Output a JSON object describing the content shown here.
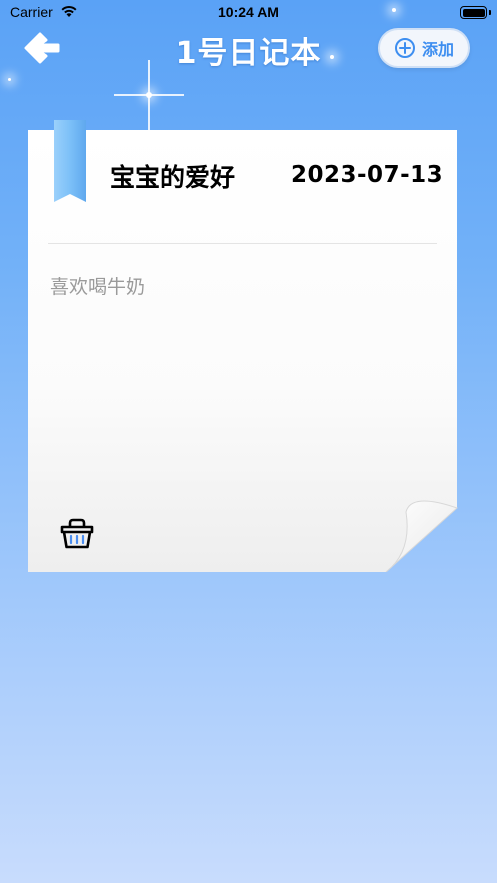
{
  "status_bar": {
    "carrier": "Carrier",
    "time": "10:24 AM"
  },
  "nav": {
    "title": "1号日记本",
    "add_label": "添加",
    "back_icon": "arrow-left-icon",
    "add_icon": "plus-circle-icon"
  },
  "note": {
    "title": "宝宝的爱好",
    "date": "2023-07-13",
    "content": "喜欢喝牛奶",
    "delete_icon": "basket-icon"
  },
  "colors": {
    "background_top": "#5aa2f6",
    "background_bottom": "#c8dcfd",
    "accent": "#3d8ef0",
    "ribbon": "#7cc0f8"
  }
}
